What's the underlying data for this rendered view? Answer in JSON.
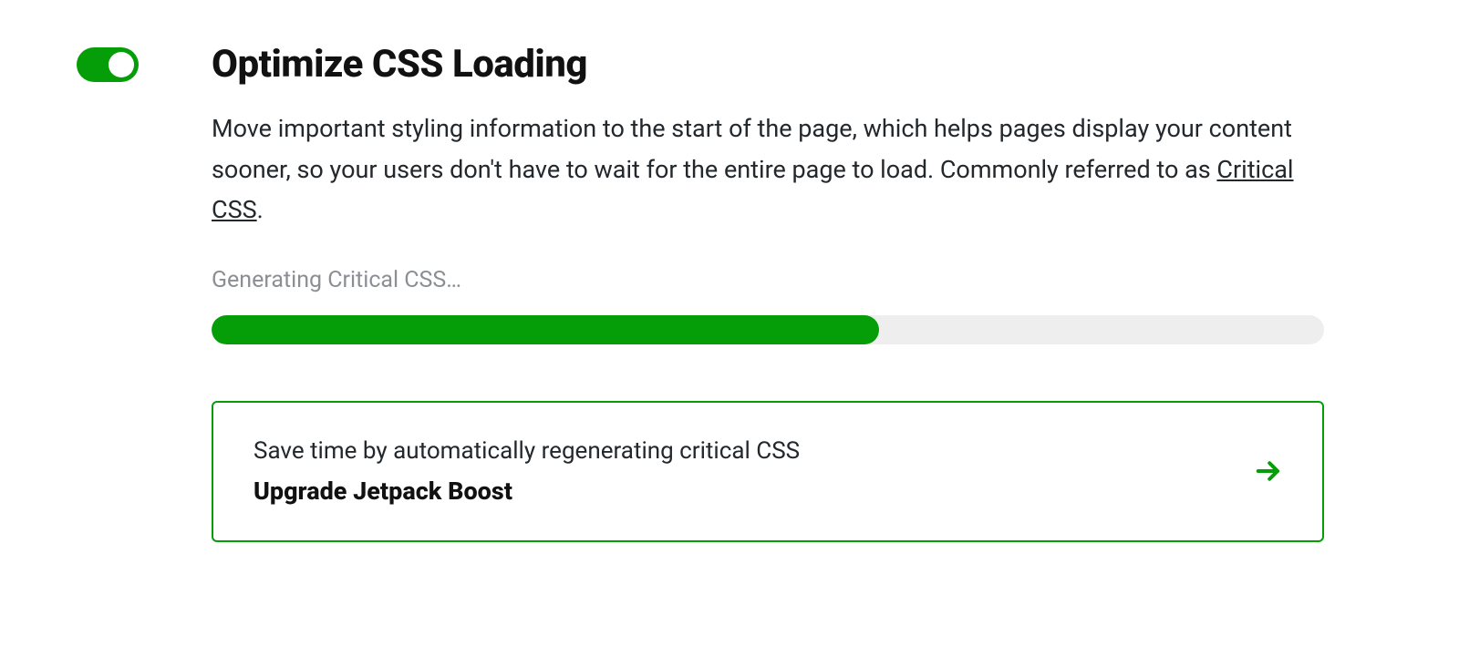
{
  "feature": {
    "enabled": true,
    "title": "Optimize CSS Loading",
    "description_before_link": "Move important styling information to the start of the page, which helps pages display your content sooner, so your users don't have to wait for the entire page to load. Commonly referred to as ",
    "link_text": "Critical CSS",
    "description_after_link": "."
  },
  "progress": {
    "status_text": "Generating Critical CSS…",
    "percent": 60
  },
  "upsell": {
    "message": "Save time by automatically regenerating critical CSS",
    "cta": "Upgrade Jetpack Boost"
  },
  "colors": {
    "green": "#069e08"
  }
}
